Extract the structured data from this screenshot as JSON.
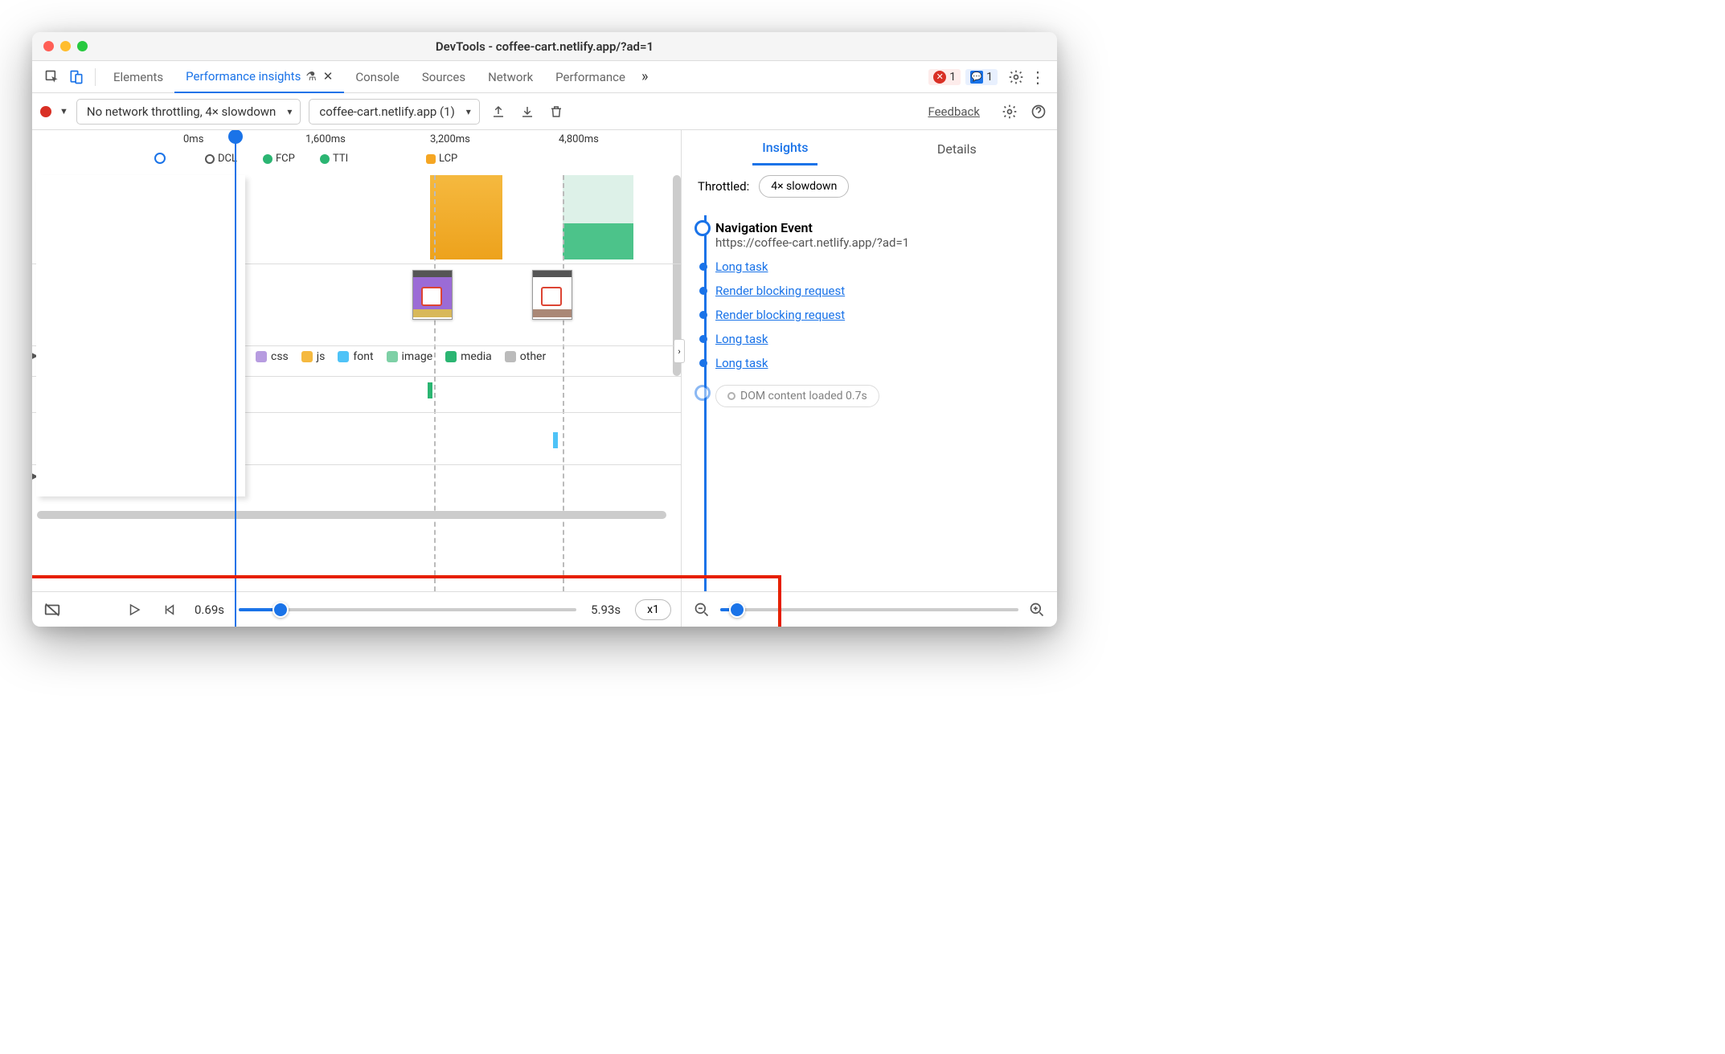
{
  "window": {
    "title": "DevTools - coffee-cart.netlify.app/?ad=1"
  },
  "tabs": {
    "elements": "Elements",
    "perf_insights": "Performance insights",
    "console": "Console",
    "sources": "Sources",
    "network": "Network",
    "performance": "Performance"
  },
  "badges": {
    "errors": "1",
    "messages": "1"
  },
  "toolbar": {
    "throttle_select": "No network throttling, 4× slowdown",
    "session_select": "coffee-cart.netlify.app (1)",
    "feedback": "Feedback"
  },
  "ruler": {
    "t0": "0ms",
    "t1": "1,600ms",
    "t2": "3,200ms",
    "t3": "4,800ms"
  },
  "markers": {
    "dcl": "DCL",
    "fcp": "FCP",
    "tti": "TTI",
    "lcp": "LCP"
  },
  "legend": {
    "css": "css",
    "js": "js",
    "font": "font",
    "image": "image",
    "media": "media",
    "other": "other"
  },
  "side": {
    "tab_insights": "Insights",
    "tab_details": "Details",
    "throttled_label": "Throttled:",
    "throttled_value": "4× slowdown",
    "nav_event_title": "Navigation Event",
    "nav_event_url": "https://coffee-cart.netlify.app/?ad=1",
    "items": [
      "Long task",
      "Render blocking request",
      "Render blocking request",
      "Long task",
      "Long task"
    ],
    "dcl_item": "DOM content loaded 0.7s"
  },
  "replay": {
    "start": "0.69s",
    "end": "5.93s",
    "speed": "x1"
  }
}
